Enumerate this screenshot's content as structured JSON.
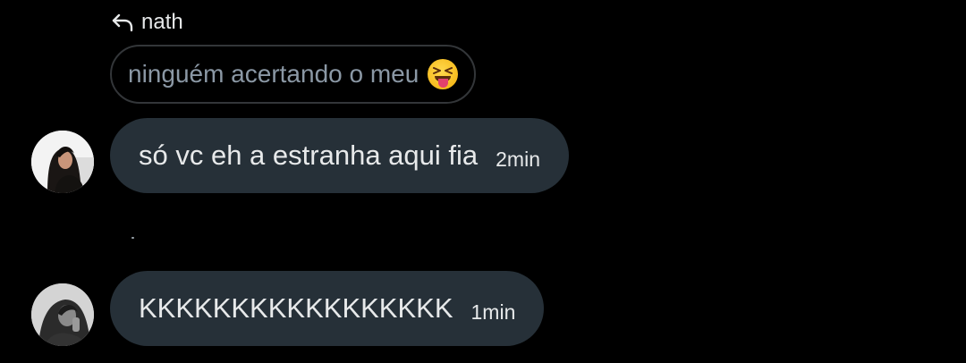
{
  "reply": {
    "icon": "reply-arrow-icon",
    "name": "nath",
    "quoted_text": "ninguém acertando o meu",
    "quoted_emoji": "squinting-face-with-tongue-icon"
  },
  "messages": [
    {
      "text": "só vc eh a estranha aqui fia",
      "time": "2min",
      "avatar": "user-avatar"
    },
    {
      "text": "KKKKKKKKKKKKKKKKK",
      "time": "1min",
      "avatar": "user-avatar"
    }
  ],
  "colors": {
    "background": "#000000",
    "bubble": "#263038",
    "quoted_border": "#333639",
    "quoted_text": "#8b98a5",
    "text": "#e7e9ea"
  }
}
